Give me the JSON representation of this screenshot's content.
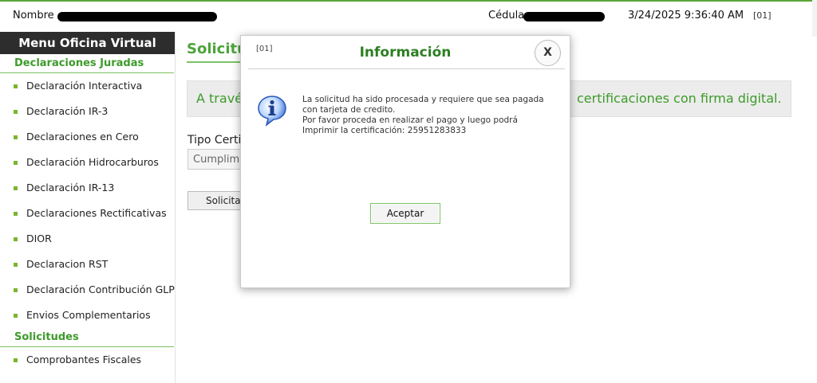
{
  "header": {
    "nombre_label": "Nombre",
    "cedula_label": "Cédula",
    "datetime": "3/24/2025 9:36:40 AM",
    "code": "[01]"
  },
  "sidebar": {
    "title": "Menu Oficina Virtual",
    "sections": [
      {
        "label": "Declaraciones Juradas",
        "items": [
          "Declaración Interactiva",
          "Declaración IR-3",
          "Declaraciones en Cero",
          "Declaración Hidrocarburos",
          "Declaración IR-13",
          "Declaraciones Rectificativas",
          "DIOR",
          "Declaracion RST",
          "Declaración Contribución GLP",
          "Envios Complementarios"
        ]
      },
      {
        "label": "Solicitudes",
        "items": [
          "Comprobantes Fiscales"
        ]
      }
    ]
  },
  "main": {
    "page_title": "Solicitu",
    "info_text_left": "A travé",
    "info_text_right": "certificaciones con firma digital.",
    "tipo_label": "Tipo Certif",
    "tipo_value": "Cumplimi",
    "solicitar_label": "Solicitar"
  },
  "dialog": {
    "code": "[01]",
    "title": "Información",
    "close_label": "X",
    "message_lines": [
      "La solicitud ha sido procesada y requiere que sea pagada",
      "con tarjeta de credito.",
      "Por favor proceda en realizar el pago y luego podrá",
      "Imprimir la certificación: 25951283833"
    ],
    "accept_label": "Aceptar",
    "icon": "info-icon"
  },
  "colors": {
    "accent_green": "#3d9b2a",
    "title_green": "#2d7f22",
    "sidebar_header": "#2d2d2d"
  }
}
